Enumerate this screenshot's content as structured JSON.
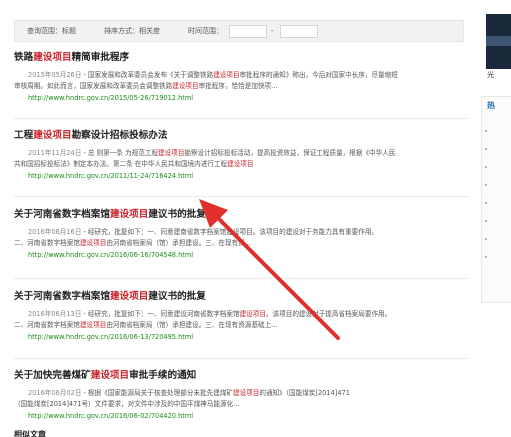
{
  "filters": {
    "scope_label": "查询范围：标题",
    "sort_label": "排序方式：相关度",
    "time_label": "时间范围：",
    "date_separator": "-"
  },
  "results": [
    {
      "title_pre": "铁路",
      "title_hl": "建设项目",
      "title_post": "精简审批程序",
      "line1_date": "2015年05月26日",
      "line1_pre": " - 国家发展和改革委员会发布《关于调整铁路",
      "line1_hl": "建设项目",
      "line1_post": "审批程序的通知》称出，今后对国家中长序，尽量缩短",
      "line2_pre": "审核周期。如此而言，国家发展和改革委员会调整铁路",
      "line2_hl": "建设项目",
      "line2_post": "审批程序，恰恰是加快项...",
      "url": "http://www.hndrc.gov.cn/2015/05-26/719012.html"
    },
    {
      "title_pre": "工程",
      "title_hl": "建设项目",
      "title_post": "勘察设计招标投标办法",
      "line1_date": "2011年11月24日",
      "line1_pre": " - 总 则第一条 为规范工程",
      "line1_hl": "建设项目",
      "line1_post": "勘察设计招标投标活动，提高投资效益，保证工程质量，根据《中华人民",
      "line2_pre": "共和国招标投标法》制定本办法。第二条 在中华人民共和国境内进行工程",
      "line2_hl": "建设项目",
      "line2_post": "",
      "url": "http://www.hndrc.gov.cn/2011/11-24/716424.html"
    },
    {
      "title_pre": "关于河南省数字档案馆",
      "title_hl": "建设项目",
      "title_post": "建议书的批复",
      "line1_date": "2016年06月16日",
      "line1_pre": " - 经研究，批复如下：一、同意建",
      "line1_hl": "",
      "line1_post": "南省数字档案馆建设项目。该项目的建设对于务能力具有重要作用。",
      "line2_pre": "二、河南省数字档案馆",
      "line2_hl": "建设项目",
      "line2_post": "由河南省档案局（馆）承担建设。三、在现有资...",
      "url": "http://www.hndrc.gov.cn/2016/06-16/704548.html"
    },
    {
      "title_pre": "关于河南省数字档案馆",
      "title_hl": "建设项目",
      "title_post": "建议书的批复",
      "line1_date": "2016年06月13日",
      "line1_pre": " - 经研究，批复如下：一、同意建设河南省数字档案馆",
      "line1_hl": "建设项目",
      "line1_post": "。该项目的建设对于提高省档案局要作用。",
      "line2_pre": "二、河南省数字档案馆",
      "line2_hl": "建设项目",
      "line2_post": "由河南省档案局（馆）承担建设。三、在现有资源基础上...",
      "url": "http://www.hndrc.gov.cn/2016/06-13/720495.html"
    },
    {
      "title_pre": "关于加快完善煤矿",
      "title_hl": "建设项目",
      "title_post": "审批手续的通知",
      "line1_date": "2016年06月02日",
      "line1_pre": " - 根据《国家能源局关于核查处理部分未批先建煤矿",
      "line1_hl": "建设项目",
      "line1_post": "的通知》（国能煤炭[2014]471",
      "line2_pre": "（国能煤炭[2014]471号）文件要求，对文件中涉及的中国平煤神马能源化...",
      "line2_hl": "",
      "line2_post": "",
      "url": "http://www.hndrc.gov.cn/2016/06-02/704420.html"
    }
  ],
  "footer_partial": "相似文章",
  "sidebar": {
    "caption": "光",
    "heading": "热",
    "items": [
      "·",
      "·",
      "·",
      "·",
      "·",
      "·",
      "·",
      "·"
    ]
  },
  "colors": {
    "highlight": "#c8252c",
    "url": "#1a8f1a",
    "annotation_arrow": "#e0302b"
  }
}
